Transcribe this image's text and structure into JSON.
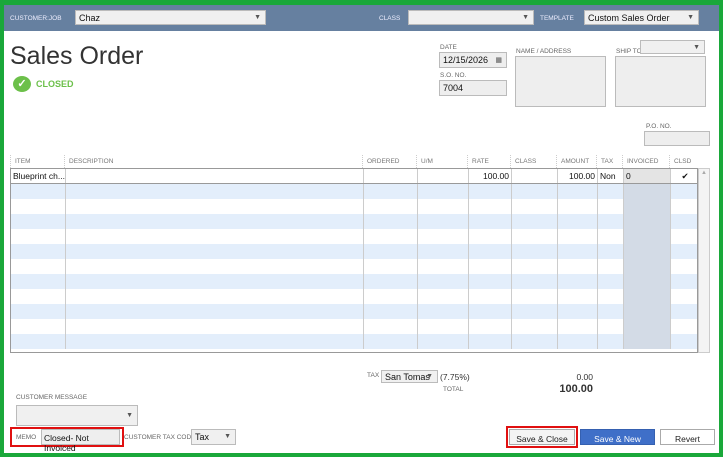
{
  "header": {
    "customer_job_label": "CUSTOMER:JOB",
    "customer_job_value": "Chaz",
    "class_label": "CLASS",
    "class_value": "",
    "template_label": "TEMPLATE",
    "template_value": "Custom Sales Order"
  },
  "title": "Sales Order",
  "status": "CLOSED",
  "date_label": "DATE",
  "date_value": "12/15/2026",
  "so_no_label": "S.O. NO.",
  "so_no_value": "7004",
  "name_address_label": "NAME / ADDRESS",
  "ship_to_label": "SHIP TO",
  "po_no_label": "P.O. NO.",
  "columns": [
    "ITEM",
    "DESCRIPTION",
    "ORDERED",
    "U/M",
    "RATE",
    "CLASS",
    "AMOUNT",
    "TAX",
    "INVOICED",
    "CLSD"
  ],
  "line_items": [
    {
      "item": "Blueprint ch...",
      "description": "",
      "ordered": "",
      "um": "",
      "rate": "100.00",
      "class": "",
      "amount": "100.00",
      "tax": "Non",
      "invoiced": "0",
      "clsd": "✔"
    }
  ],
  "tax_label": "TAX",
  "tax_item": "San Tomas",
  "tax_rate": "(7.75%)",
  "tax_amount": "0.00",
  "total_label": "TOTAL",
  "total_value": "100.00",
  "customer_message_label": "CUSTOMER MESSAGE",
  "memo_label": "MEMO",
  "memo_value": "Closed- Not Invoiced",
  "customer_tax_code_label": "CUSTOMER TAX CODE",
  "customer_tax_code_value": "Tax",
  "buttons": {
    "save_close": "Save & Close",
    "save_new": "Save & New",
    "revert": "Revert"
  },
  "colors": {
    "header": "#6680a0",
    "border": "#1aa83a",
    "closed": "#6cc04a",
    "primary": "#3f6fc8",
    "highlight": "#e01010"
  }
}
